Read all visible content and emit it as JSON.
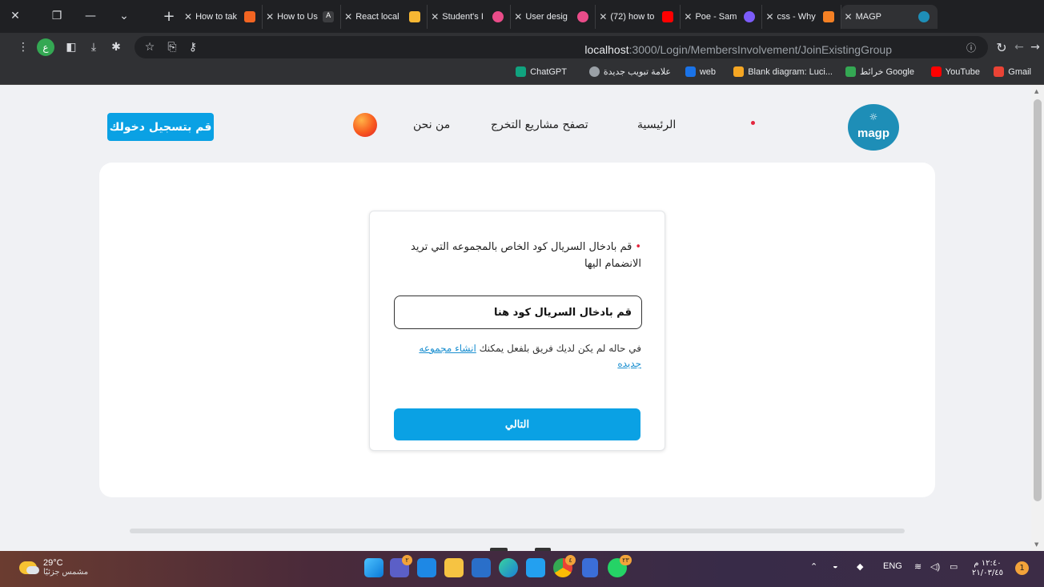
{
  "browser": {
    "tabs": [
      {
        "title": "How to tak",
        "color": "#f26522"
      },
      {
        "title": "How to Us",
        "color": "#3c3d40"
      },
      {
        "title": "React local",
        "color": "#f7b733"
      },
      {
        "title": "Student's I",
        "color": "#ea4c89"
      },
      {
        "title": "User desig",
        "color": "#ea4c89"
      },
      {
        "title": "(72) how to",
        "color": "#ff0000"
      },
      {
        "title": "Poe - Sam",
        "color": "#7c5cfa"
      },
      {
        "title": "css - Why",
        "color": "#f48024"
      }
    ],
    "active_tab": {
      "title": "MAGP"
    },
    "url_host": "localhost",
    "url_path": ":3000/Login/MembersInvolvement/JoinExistingGroup",
    "profile_letter": "ع",
    "bookmarks": [
      {
        "label": "Gmail",
        "color": "#ea4335"
      },
      {
        "label": "YouTube",
        "color": "#ff0000"
      },
      {
        "label": "خرائط Google",
        "color": "#34a853"
      },
      {
        "label": "Blank diagram: Luci...",
        "color": "#f5a623"
      },
      {
        "label": "web",
        "color": "#1a73e8"
      },
      {
        "label": "علامة تبويب جديدة",
        "color": "#9aa0a6"
      },
      {
        "label": "ChatGPT",
        "color": "#10a37f"
      }
    ]
  },
  "site": {
    "logo_text": "magp",
    "nav": {
      "home": "الرئيسية",
      "projects": "تصفح مشاريع التخرج",
      "about": "من نحن"
    },
    "login_button": "قم بتسجيل دخولك"
  },
  "form": {
    "required_mark": "•",
    "label": "قم بادخال السريال كود الخاص بالمجموعه التي تريد الانضمام اليها",
    "input_placeholder": "قم بادخال السريال كود هنا",
    "note_text": "في حاله لم يكن لديك فريق بلفعل يمكنك ",
    "note_link": "انشاء مجموعه جديده",
    "next_button": "التالي"
  },
  "taskbar": {
    "temperature": "29°C",
    "weather": "مشمس جزئيًا",
    "language": "ENG",
    "time": "١٢:٤٠ م",
    "date": "٢١/٠٣/٤٥",
    "notifications": "1",
    "badge_teams": "٢",
    "badge_chrome": "٤",
    "badge_whatsapp": "٢٣"
  }
}
